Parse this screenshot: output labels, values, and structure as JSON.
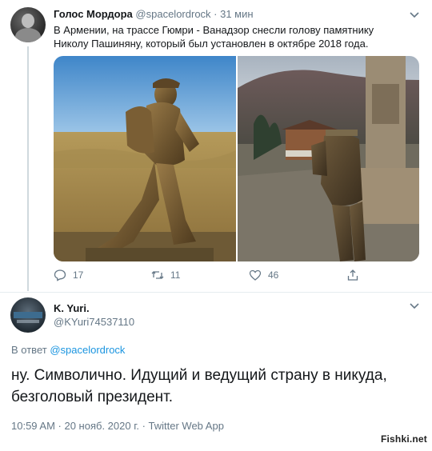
{
  "tweet1": {
    "author_name": "Голос Мордора",
    "author_handle": "@spacelordrock",
    "separator": " · ",
    "time": "31 мин",
    "text": "В Армении, на трассе Гюмри - Ванадзор снесли голову памятнику Николу Пашиняну, который был установлен в октябре 2018 года.",
    "actions": {
      "reply_count": "17",
      "retweet_count": "11",
      "like_count": "46"
    }
  },
  "tweet2": {
    "author_name": "K. Yuri.",
    "author_handle": "@KYuri74537110",
    "reply_prefix": "В ответ ",
    "reply_mention": "@spacelordrock",
    "text": "ну. Символично. Идущий и ведущий страну в никуда, безголовый президент.",
    "meta": "10:59 AM · 20 нояб. 2020 г. · Twitter Web App"
  },
  "watermark": "Fishki.net",
  "icons": {
    "reply": "reply-icon",
    "retweet": "retweet-icon",
    "like": "like-icon",
    "share": "share-icon",
    "more": "chevron-down-icon"
  },
  "colors": {
    "text": "#14171a",
    "secondary": "#657786",
    "link": "#1b95e0",
    "divider": "#e6ecf0"
  }
}
